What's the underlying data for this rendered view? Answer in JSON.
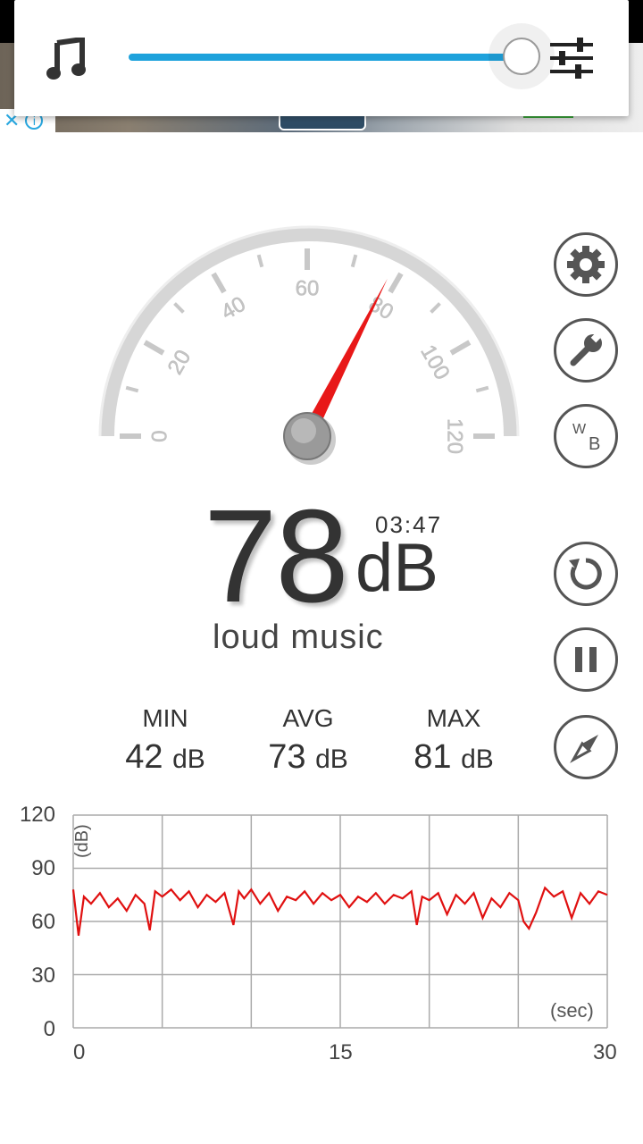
{
  "volume_panel": {
    "level": 0.92,
    "music_icon": "music-note-icon",
    "eq_icon": "equalizer-sliders-icon"
  },
  "ad": {
    "close_icon": "close-x-icon",
    "info_icon": "info-icon"
  },
  "gauge": {
    "value": 78,
    "min": 0,
    "max": 120,
    "labels": [
      "0",
      "20",
      "40",
      "60",
      "80",
      "100",
      "120"
    ]
  },
  "reading": {
    "value": "78",
    "unit": "dB",
    "timer": "03:47",
    "description": "loud music"
  },
  "stats": [
    {
      "label": "MIN",
      "value": "42",
      "unit": "dB"
    },
    {
      "label": "AVG",
      "value": "73",
      "unit": "dB"
    },
    {
      "label": "MAX",
      "value": "81",
      "unit": "dB"
    }
  ],
  "side_buttons": [
    "gear-icon",
    "wrench-icon",
    "white-balance-icon",
    "reset-icon",
    "pause-icon",
    "compass-icon"
  ],
  "wb_label": {
    "w": "W",
    "b": "B"
  },
  "chart_data": {
    "type": "line",
    "ylabel": "(dB)",
    "xlabel": "(sec)",
    "ylim": [
      0,
      120
    ],
    "xlim": [
      0,
      30
    ],
    "yticks": [
      "120",
      "90",
      "60",
      "30",
      "0"
    ],
    "xticks": [
      "0",
      "15",
      "30"
    ],
    "grid": true,
    "series": [
      {
        "color": "#e01010",
        "x": [
          0,
          0.3,
          0.6,
          1,
          1.5,
          2,
          2.5,
          3,
          3.5,
          4,
          4.3,
          4.6,
          5,
          5.5,
          6,
          6.5,
          7,
          7.5,
          8,
          8.5,
          9,
          9.3,
          9.6,
          10,
          10.5,
          11,
          11.5,
          12,
          12.5,
          13,
          13.5,
          14,
          14.5,
          15,
          15.5,
          16,
          16.5,
          17,
          17.5,
          18,
          18.5,
          19,
          19.3,
          19.6,
          20,
          20.5,
          21,
          21.5,
          22,
          22.5,
          23,
          23.5,
          24,
          24.5,
          25,
          25.3,
          25.6,
          26,
          26.5,
          27,
          27.5,
          28,
          28.5,
          29,
          29.5,
          30
        ],
        "y": [
          78,
          52,
          74,
          70,
          76,
          68,
          73,
          66,
          75,
          70,
          55,
          77,
          74,
          78,
          72,
          77,
          68,
          75,
          71,
          76,
          58,
          77,
          73,
          78,
          70,
          76,
          66,
          74,
          72,
          77,
          70,
          76,
          72,
          75,
          68,
          74,
          71,
          76,
          70,
          75,
          73,
          77,
          58,
          74,
          72,
          76,
          64,
          75,
          70,
          76,
          62,
          73,
          68,
          76,
          72,
          60,
          56,
          65,
          79,
          74,
          77,
          62,
          76,
          70,
          77,
          75
        ]
      }
    ]
  }
}
